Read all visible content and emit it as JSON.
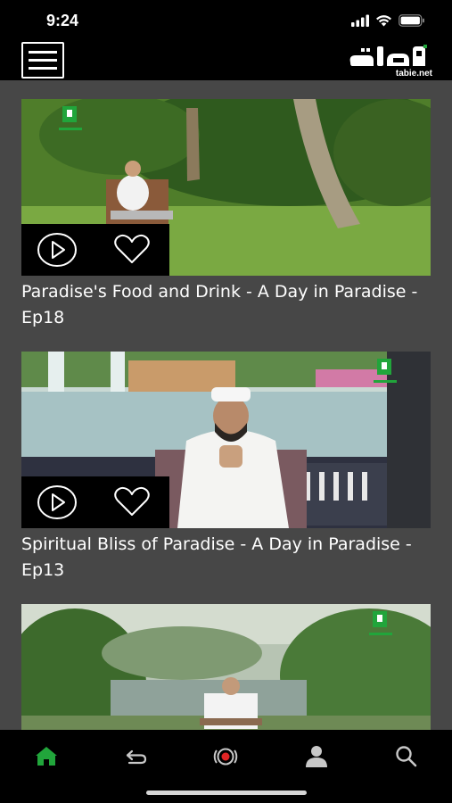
{
  "status_bar": {
    "time": "9:24",
    "icons": [
      "signal-icon",
      "wifi-icon",
      "battery-icon"
    ]
  },
  "header": {
    "menu_icon": "hamburger-menu-icon",
    "logo_text": "tabie.net"
  },
  "videos": [
    {
      "title": "Paradise's Food and Drink - A Day in Paradise - Ep18",
      "liked": false
    },
    {
      "title": "Spiritual Bliss of Paradise - A Day in Paradise - Ep13",
      "liked": false
    },
    {
      "title": "",
      "liked": false
    }
  ],
  "bottom_nav": {
    "items": [
      "home-icon",
      "back-arrow-icon",
      "live-broadcast-icon",
      "profile-icon",
      "search-icon"
    ],
    "active": "home-icon",
    "active_color": "#21a53b",
    "inactive_color": "#c8c8c8"
  },
  "colors": {
    "background": "#474747",
    "bar": "#000000",
    "text": "#ffffff"
  }
}
